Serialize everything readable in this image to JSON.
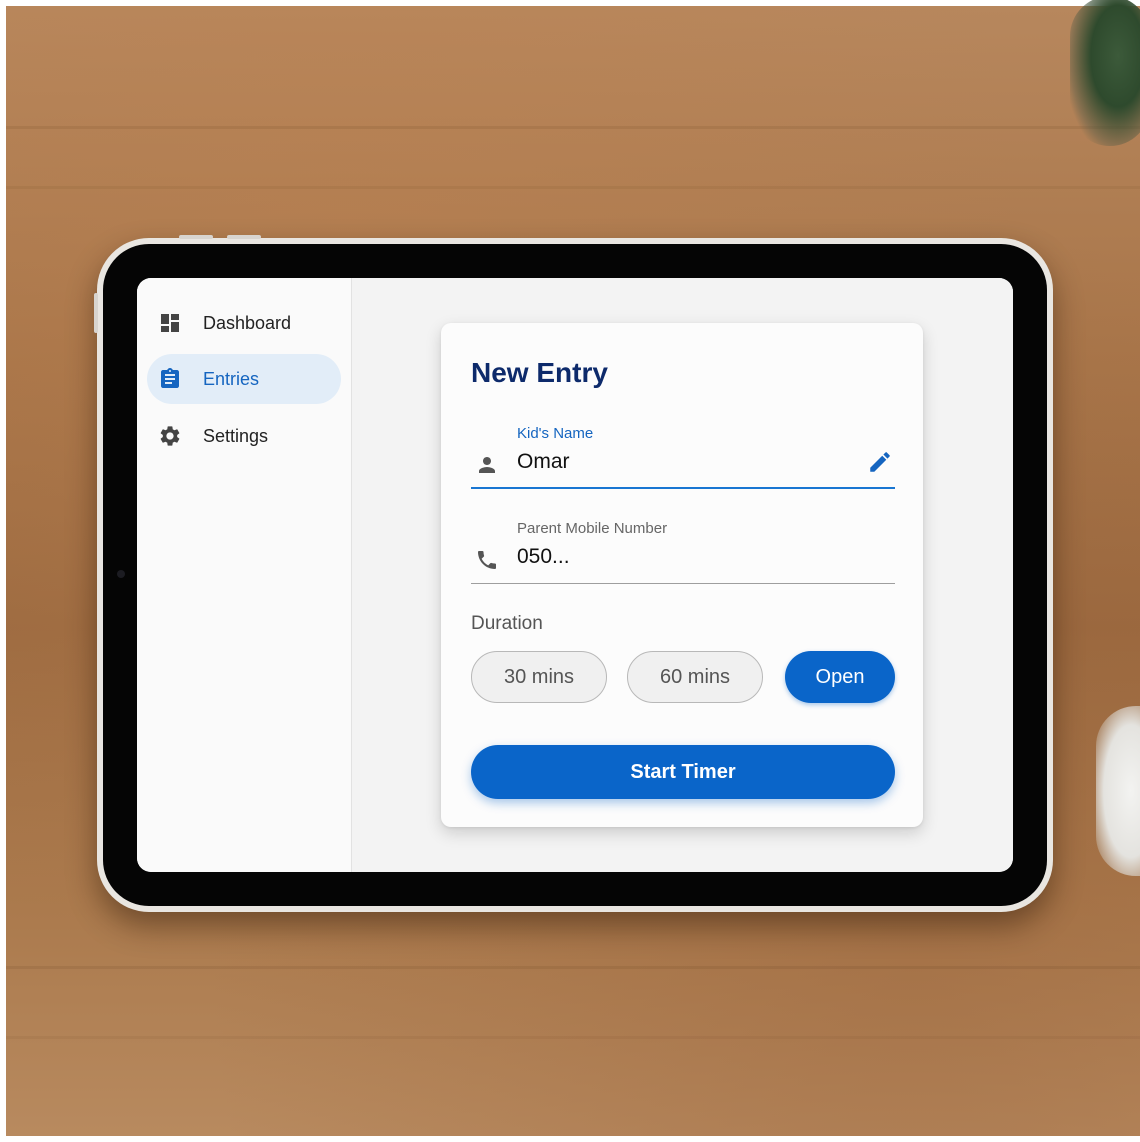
{
  "sidebar": {
    "items": [
      {
        "label": "Dashboard",
        "icon": "dashboard-icon",
        "active": false
      },
      {
        "label": "Entries",
        "icon": "clipboard-icon",
        "active": true
      },
      {
        "label": "Settings",
        "icon": "gear-icon",
        "active": false
      }
    ]
  },
  "form": {
    "title": "New Entry",
    "kid_name": {
      "label": "Kid's Name",
      "value": "Omar",
      "icon": "person-icon",
      "action_icon": "pencil-icon"
    },
    "parent_mobile": {
      "label": "Parent Mobile Number",
      "value": "050...",
      "icon": "phone-icon"
    },
    "duration": {
      "label": "Duration",
      "options": [
        "30 mins",
        "60 mins",
        "Open"
      ],
      "selected": "Open"
    },
    "submit_label": "Start Timer"
  },
  "colors": {
    "primary": "#0a65c9",
    "title": "#0d2a6b",
    "active_nav_bg": "#e2edf8"
  }
}
